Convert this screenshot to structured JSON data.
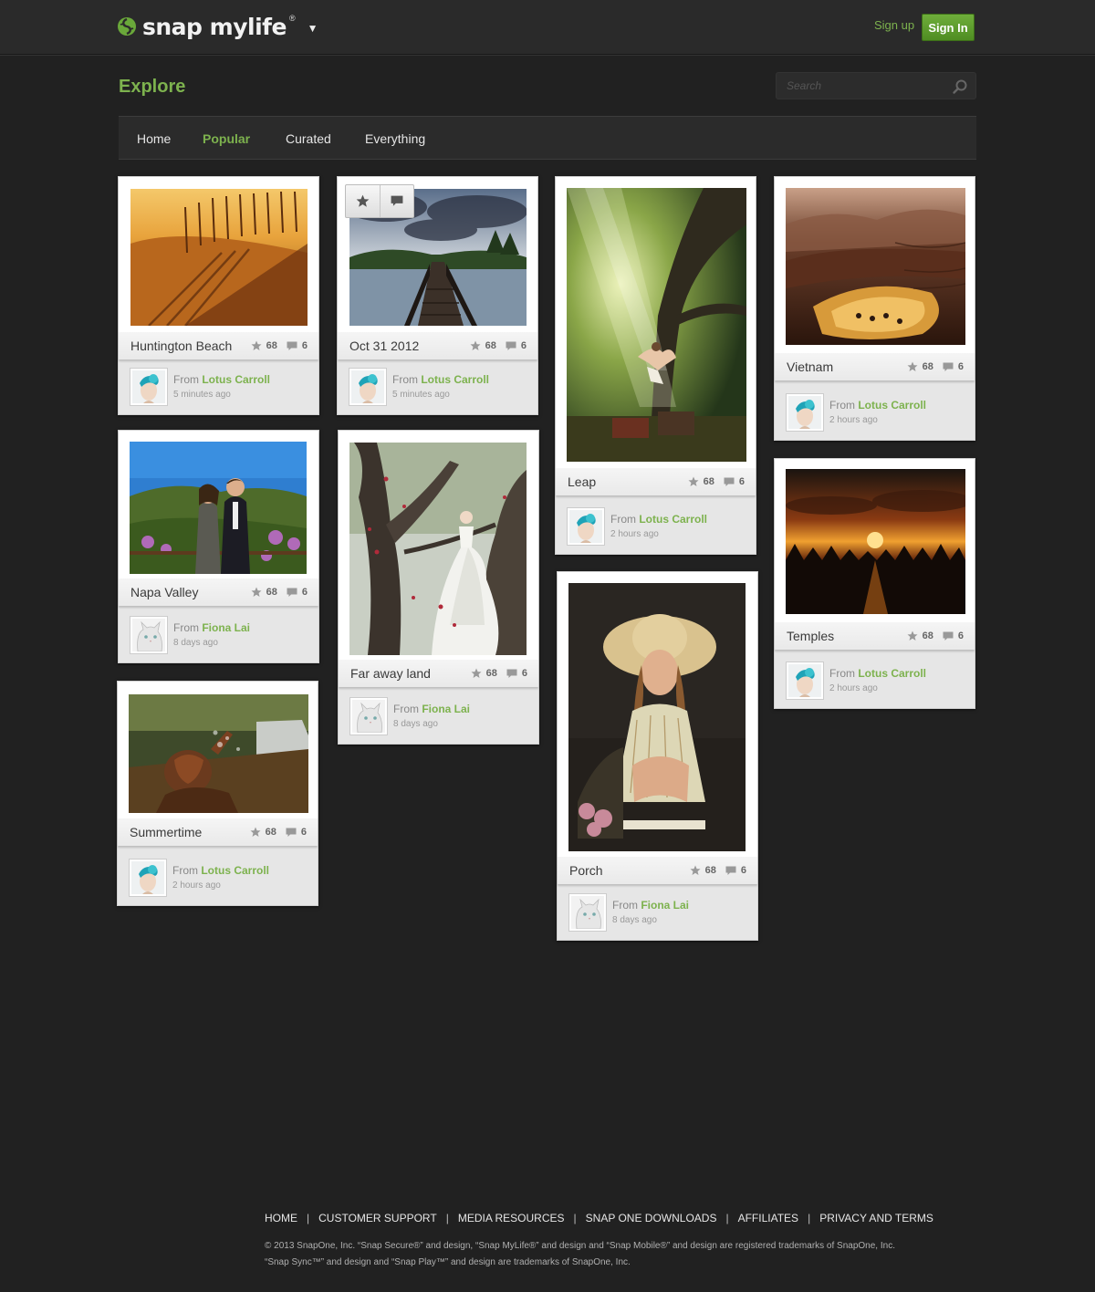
{
  "header": {
    "logo_text": "snap mylife",
    "logo_reg": "®",
    "signup_label": "Sign up",
    "signin_label": "Sign In",
    "brand_color": "#7db24e"
  },
  "explore": {
    "title": "Explore",
    "search_placeholder": "Search"
  },
  "tabs": [
    "Home",
    "Popular",
    "Curated",
    "Everything"
  ],
  "active_tab": "Popular",
  "stat_icons": {
    "favorites": "star-icon",
    "comments": "comment-icon"
  },
  "cards": [
    {
      "title": "Huntington Beach",
      "favorites": "68",
      "comments": "6",
      "from_label": "From",
      "owner": "Lotus Carroll",
      "time": "5 minutes ago"
    },
    {
      "title": "Napa Valley",
      "favorites": "68",
      "comments": "6",
      "from_label": "From",
      "owner": "Fiona Lai",
      "time": "8 days ago"
    },
    {
      "title": "Summertime",
      "favorites": "68",
      "comments": "6",
      "from_label": "From",
      "owner": "Lotus Carroll",
      "time": "2 hours ago"
    },
    {
      "title": "Oct 31 2012",
      "favorites": "68",
      "comments": "6",
      "from_label": "From",
      "owner": "Lotus Carroll",
      "time": "5 minutes ago"
    },
    {
      "title": "Far away land",
      "favorites": "68",
      "comments": "6",
      "from_label": "From",
      "owner": "Fiona Lai",
      "time": "8 days ago"
    },
    {
      "title": "Leap",
      "favorites": "68",
      "comments": "6",
      "from_label": "From",
      "owner": "Lotus Carroll",
      "time": "2 hours ago"
    },
    {
      "title": "Porch",
      "favorites": "68",
      "comments": "6",
      "from_label": "From",
      "owner": "Fiona Lai",
      "time": "8 days ago"
    },
    {
      "title": "Vietnam",
      "favorites": "68",
      "comments": "6",
      "from_label": "From",
      "owner": "Lotus Carroll",
      "time": "2 hours ago"
    },
    {
      "title": "Temples",
      "favorites": "68",
      "comments": "6",
      "from_label": "From",
      "owner": "Lotus Carroll",
      "time": "2 hours ago"
    }
  ],
  "footer": {
    "links": [
      "HOME",
      "CUSTOMER SUPPORT",
      "MEDIA RESOURCES",
      "SNAP ONE DOWNLOADS",
      "AFFILIATES",
      "PRIVACY AND TERMS"
    ],
    "separator": "|",
    "copyright_line1": "© 2013 SnapOne, Inc. “Snap Secure®” and design, “Snap MyLife®” and design and “Snap Mobile®” and design are registered trademarks of SnapOne, Inc.",
    "copyright_line2": "“Snap Sync™” and design and “Snap Play™” and design are trademarks of SnapOne, Inc."
  }
}
